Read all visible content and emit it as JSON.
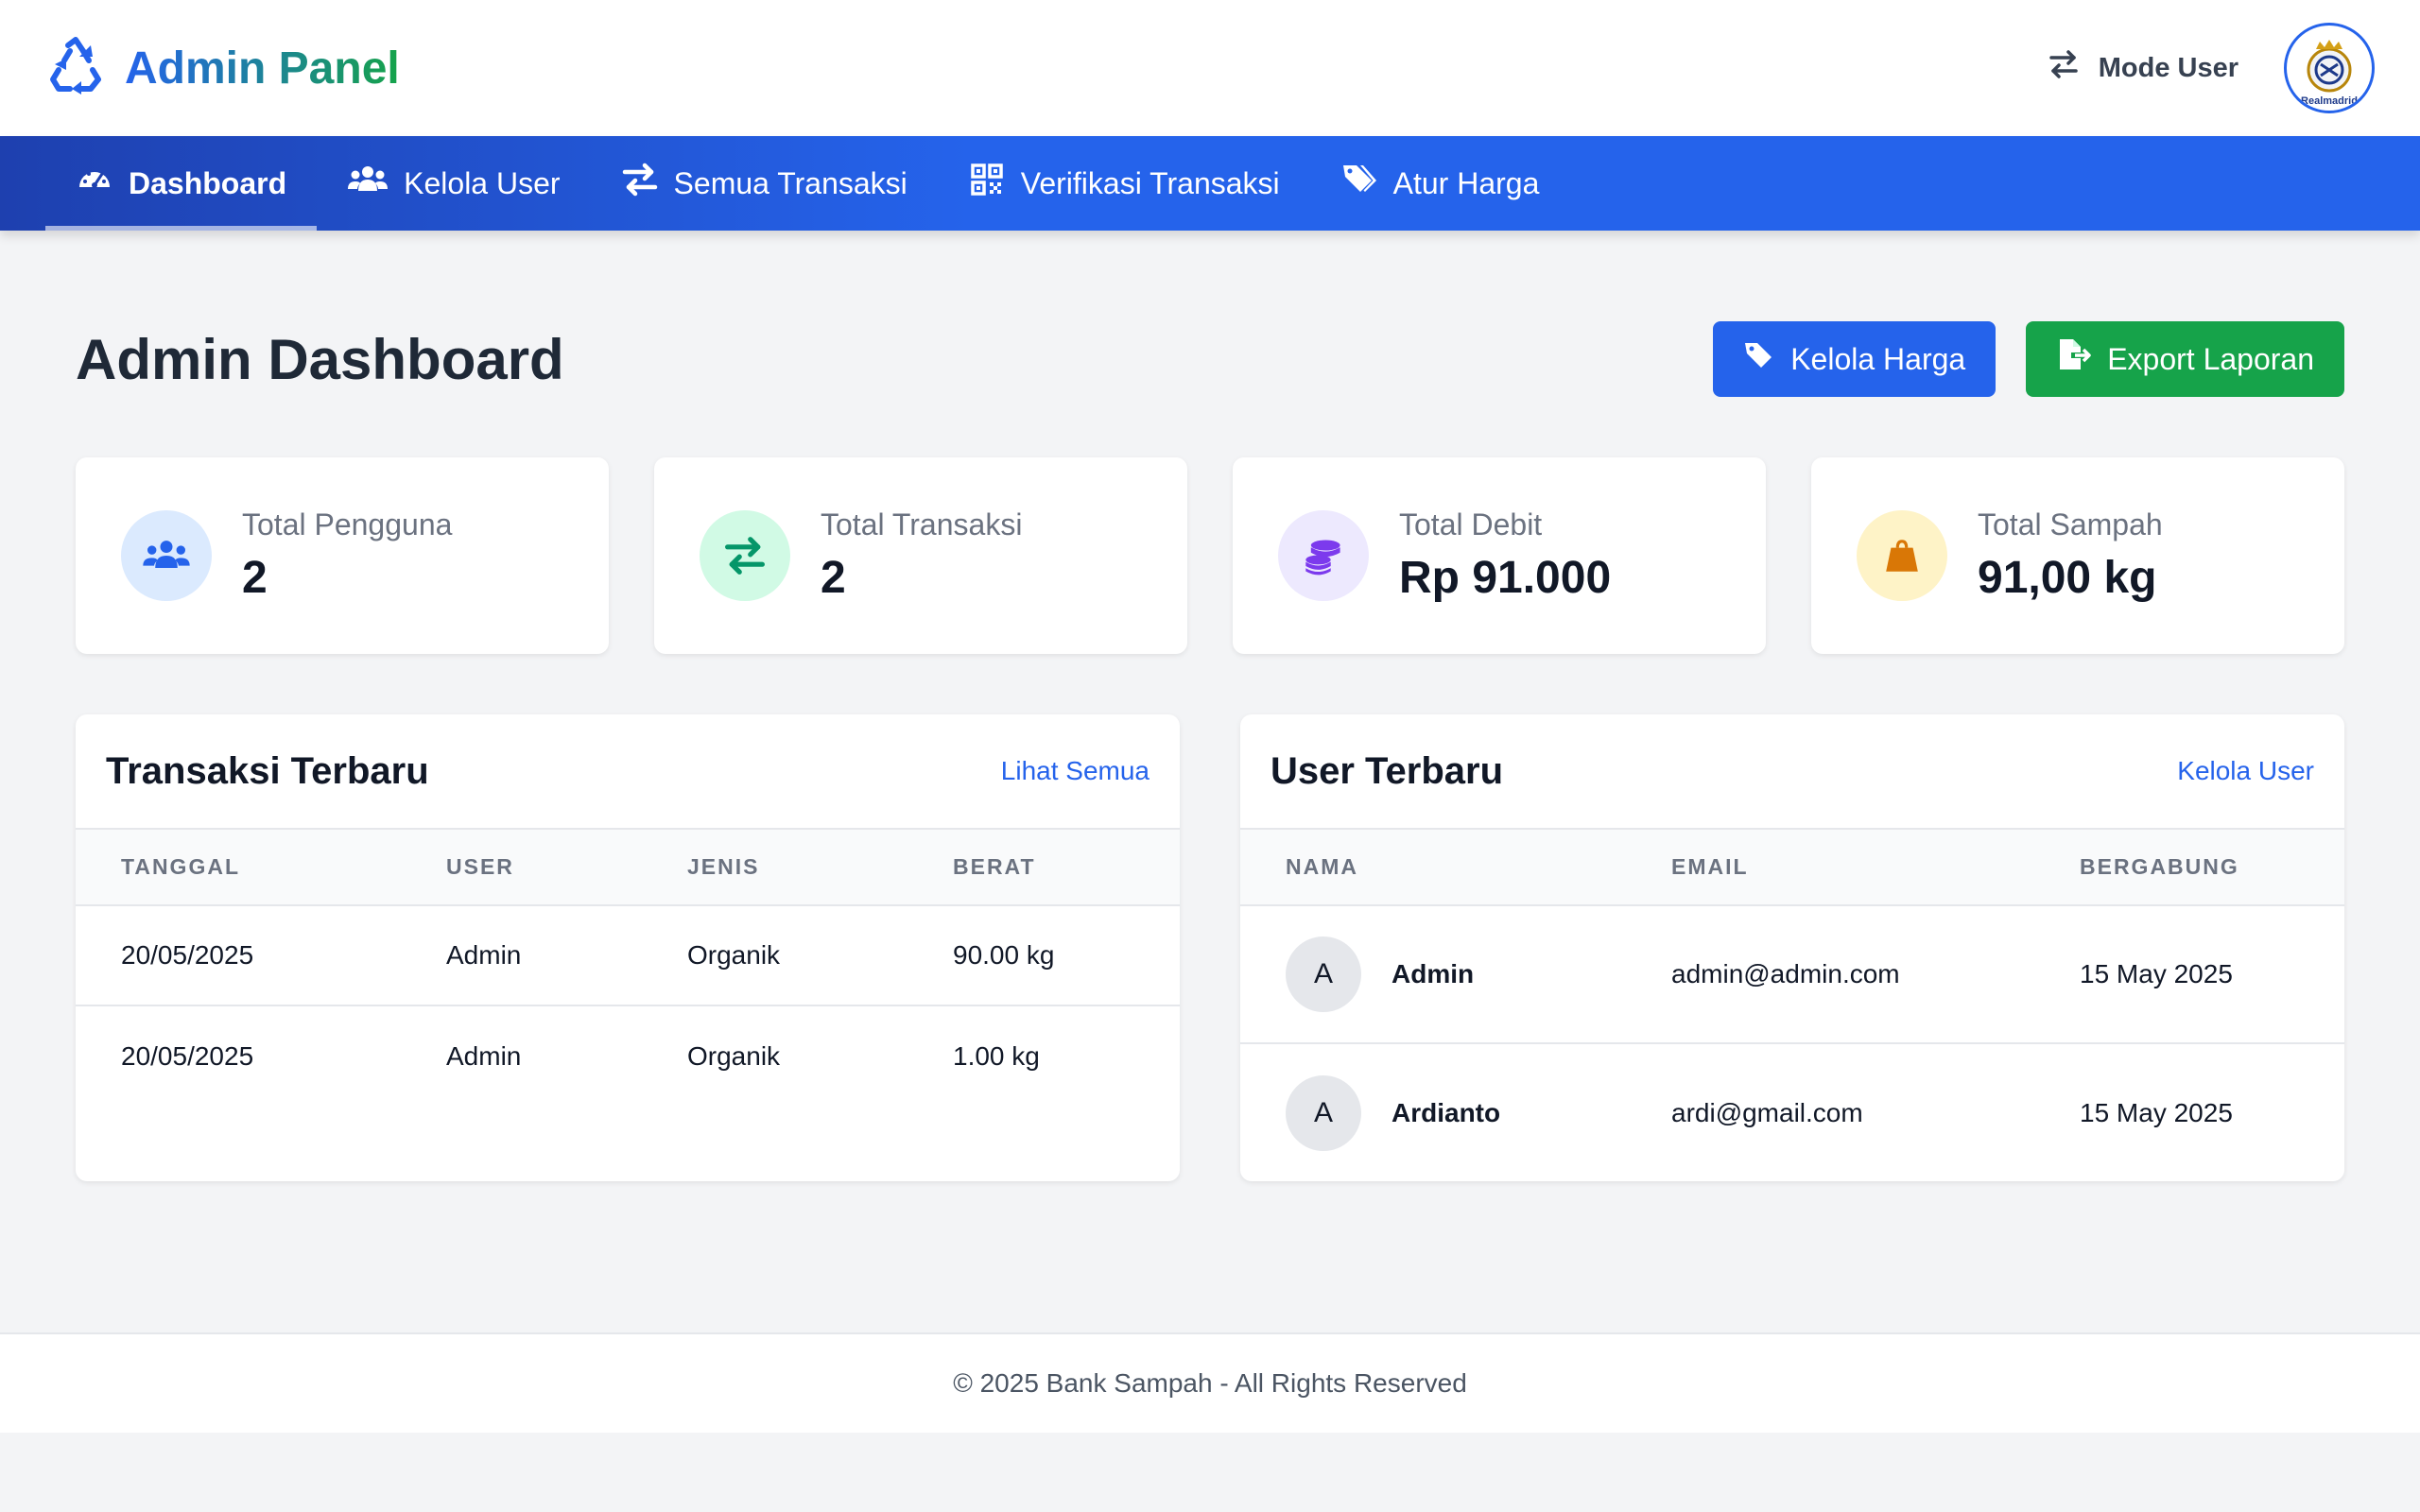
{
  "header": {
    "brand": "Admin Panel",
    "mode_user": "Mode User",
    "avatar_text": "Realmadrid"
  },
  "nav": {
    "items": [
      {
        "label": "Dashboard",
        "icon": "gauge-icon",
        "active": true
      },
      {
        "label": "Kelola User",
        "icon": "users-icon"
      },
      {
        "label": "Semua Transaksi",
        "icon": "exchange-icon"
      },
      {
        "label": "Verifikasi Transaksi",
        "icon": "qrcode-icon"
      },
      {
        "label": "Atur Harga",
        "icon": "tags-icon"
      }
    ]
  },
  "page": {
    "title": "Admin Dashboard",
    "actions": {
      "kelola_harga": "Kelola Harga",
      "export_laporan": "Export Laporan"
    }
  },
  "stats": [
    {
      "label": "Total Pengguna",
      "value": "2",
      "icon": "users-icon",
      "color": "#2563eb",
      "bg": "#dbeafe"
    },
    {
      "label": "Total Transaksi",
      "value": "2",
      "icon": "exchange-icon",
      "color": "#059669",
      "bg": "#d1fae5"
    },
    {
      "label": "Total Debit",
      "value": "Rp 91.000",
      "icon": "coins-icon",
      "color": "#7c3aed",
      "bg": "#ede9fe"
    },
    {
      "label": "Total Sampah",
      "value": "91,00 kg",
      "icon": "weight-bag-icon",
      "color": "#d97706",
      "bg": "#fef3c7"
    }
  ],
  "transactions": {
    "title": "Transaksi Terbaru",
    "link": "Lihat Semua",
    "columns": [
      "TANGGAL",
      "USER",
      "JENIS",
      "BERAT"
    ],
    "rows": [
      [
        "20/05/2025",
        "Admin",
        "Organik",
        "90.00 kg"
      ],
      [
        "20/05/2025",
        "Admin",
        "Organik",
        "1.00 kg"
      ]
    ]
  },
  "users": {
    "title": "User Terbaru",
    "link": "Kelola User",
    "columns": [
      "NAMA",
      "EMAIL",
      "BERGABUNG"
    ],
    "rows": [
      {
        "initial": "A",
        "name": "Admin",
        "email": "admin@admin.com",
        "joined": "15 May 2025"
      },
      {
        "initial": "A",
        "name": "Ardianto",
        "email": "ardi@gmail.com",
        "joined": "15 May 2025"
      }
    ]
  },
  "footer": {
    "text": "© 2025 Bank Sampah - All Rights Reserved"
  },
  "colors": {
    "primary": "#2563eb",
    "success": "#16a34a",
    "background": "#f3f4f6"
  }
}
